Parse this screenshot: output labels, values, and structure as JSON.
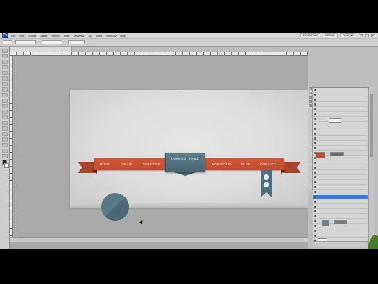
{
  "app": {
    "title": "Ps",
    "menu": [
      "File",
      "Edit",
      "Image",
      "Layer",
      "Select",
      "Filter",
      "Analysis",
      "3D",
      "View",
      "Window",
      "Help"
    ],
    "workspaces": [
      "ESSENTIALS",
      "DESIGN",
      "PAINTING"
    ],
    "window_controls": [
      "–",
      "□",
      "×"
    ]
  },
  "options_bar": {
    "fields": [
      "",
      "",
      "",
      ""
    ],
    "labels": [
      "",
      ""
    ]
  },
  "document_tab": {
    "label": ""
  },
  "canvas": {
    "nav": {
      "left_links": [
        "HOME",
        "ABOUT",
        "SERVICES"
      ],
      "right_links": [
        "PORTFOLIO",
        "BLOG",
        "CONTACT"
      ],
      "company_name": "COMPANY NAME"
    },
    "social": {
      "twitter_glyph": "t",
      "facebook_glyph": "f"
    },
    "colors": {
      "ribbon": "#c24d30",
      "badge": "#4a6674",
      "circle": "#5a7888",
      "document_bg": "#dcdcdc"
    }
  },
  "status_bar": {
    "zoom": "",
    "doc_info": ""
  },
  "tools": {
    "icons": [
      "move-icon",
      "marquee-icon",
      "lasso-icon",
      "quick-select-icon",
      "crop-icon",
      "eyedropper-icon",
      "healing-icon",
      "brush-icon",
      "stamp-icon",
      "history-brush-icon",
      "eraser-icon",
      "gradient-icon",
      "blur-icon",
      "dodge-icon",
      "pen-icon",
      "type-icon",
      "path-select-icon",
      "shape-icon",
      "hand-icon",
      "zoom-icon"
    ]
  },
  "layers": {
    "rows": [
      {
        "name": "",
        "selected": false
      },
      {
        "name": "",
        "selected": false
      },
      {
        "name": "",
        "selected": false
      },
      {
        "name": "",
        "selected": false
      },
      {
        "name": "",
        "selected": false
      },
      {
        "name": "",
        "selected": false
      },
      {
        "name": "",
        "selected": false
      },
      {
        "name": "",
        "selected": false
      },
      {
        "name": "",
        "selected": false
      },
      {
        "name": "",
        "selected": false
      },
      {
        "name": "",
        "selected": false
      },
      {
        "name": "",
        "selected": false
      },
      {
        "name": "",
        "selected": false
      },
      {
        "name": "",
        "selected": false
      },
      {
        "name": "",
        "selected": false
      },
      {
        "name": "",
        "selected": false
      },
      {
        "name": "",
        "selected": false
      },
      {
        "name": "",
        "selected": false
      },
      {
        "name": "",
        "selected": false
      },
      {
        "name": "",
        "selected": false
      },
      {
        "name": "",
        "selected": false
      },
      {
        "name": "",
        "selected": false
      },
      {
        "name": "",
        "selected": true
      },
      {
        "name": "",
        "selected": false
      },
      {
        "name": "",
        "selected": false
      },
      {
        "name": "",
        "selected": false
      },
      {
        "name": "",
        "selected": false
      },
      {
        "name": "",
        "selected": false
      },
      {
        "name": "",
        "selected": false
      },
      {
        "name": "",
        "selected": false
      },
      {
        "name": "",
        "selected": false
      },
      {
        "name": "",
        "selected": false
      },
      {
        "name": "",
        "selected": false
      }
    ]
  }
}
